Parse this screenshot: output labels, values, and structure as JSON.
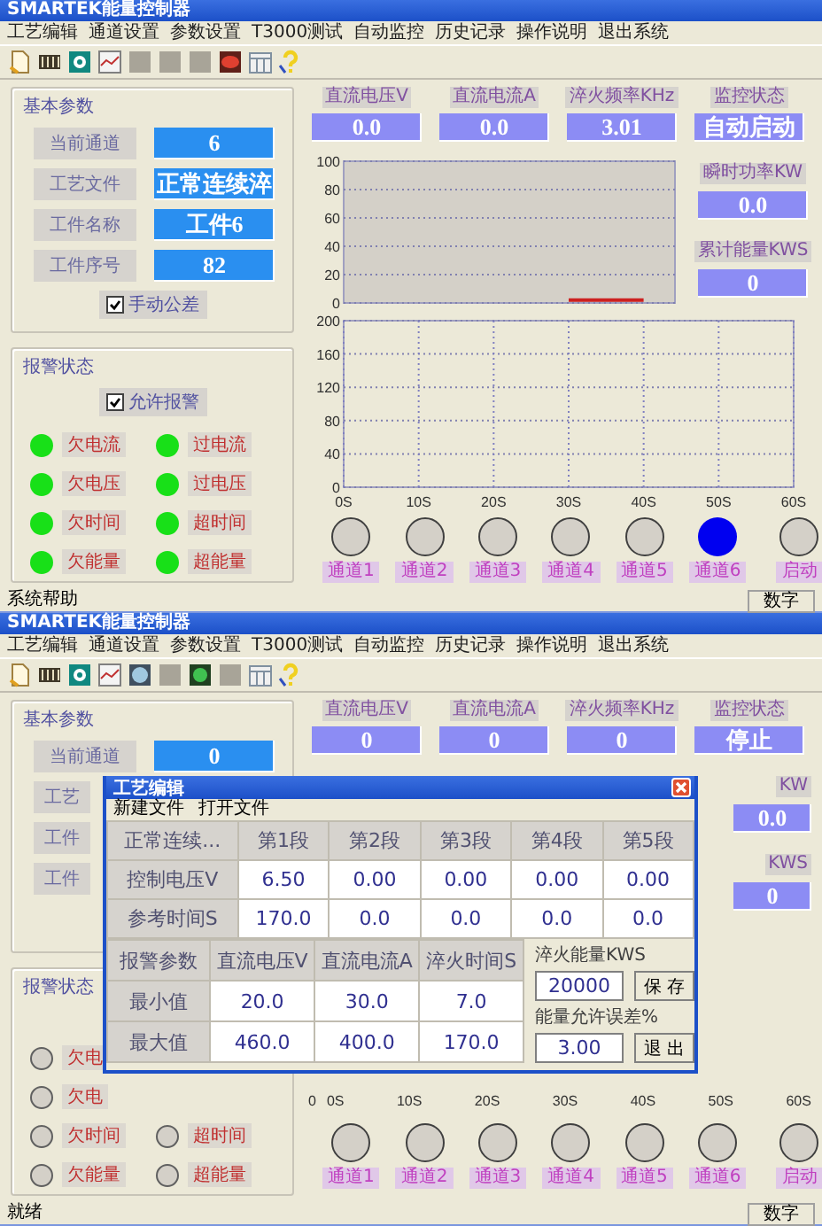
{
  "windows": [
    {
      "title": "SMARTEK能量控制器",
      "menu": [
        "工艺编辑",
        "通道设置",
        "参数设置",
        "T3000测试",
        "自动监控",
        "历史记录",
        "操作说明",
        "退出系统"
      ],
      "toolbar": [
        {
          "kind": "document"
        },
        {
          "kind": "film"
        },
        {
          "kind": "disc"
        },
        {
          "kind": "chart"
        },
        {
          "kind": "blank"
        },
        {
          "kind": "blank"
        },
        {
          "kind": "blank"
        },
        {
          "kind": "oval"
        },
        {
          "kind": "calendar"
        },
        {
          "kind": "help"
        }
      ],
      "basic": {
        "title": "基本参数",
        "fields": [
          {
            "label": "当前通道",
            "value": "6"
          },
          {
            "label": "工艺文件",
            "value": "正常连续淬"
          },
          {
            "label": "工件名称",
            "value": "工件6"
          },
          {
            "label": "工件序号",
            "value": "82"
          }
        ],
        "checkbox": {
          "label": "手动公差",
          "checked": true
        }
      },
      "alarm": {
        "title": "报警状态",
        "enable": {
          "label": "允许报警",
          "checked": true
        },
        "indicators": [
          {
            "kind": "lamp",
            "label": "欠电流",
            "on": true
          },
          {
            "kind": "lamp",
            "label": "过电流",
            "on": true
          },
          {
            "kind": "lamp",
            "label": "欠电压",
            "on": true
          },
          {
            "kind": "lamp",
            "label": "过电压",
            "on": true
          },
          {
            "kind": "lamp",
            "label": "欠时间",
            "on": true
          },
          {
            "kind": "lamp",
            "label": "超时间",
            "on": true
          },
          {
            "kind": "lamp",
            "label": "欠能量",
            "on": true
          },
          {
            "kind": "lamp",
            "label": "超能量",
            "on": true
          }
        ]
      },
      "readouts": [
        {
          "label": "直流电压V",
          "value": "0.0"
        },
        {
          "label": "直流电流A",
          "value": "0.0"
        },
        {
          "label": "淬火频率KHz",
          "value": "3.01"
        },
        {
          "label": "监控状态",
          "value": "自动启动"
        }
      ],
      "side_readouts": [
        {
          "label": "瞬时功率KW",
          "value": "0.0"
        },
        {
          "label": "累计能量KWS",
          "value": "0"
        }
      ],
      "charts": [
        {
          "shaded": true,
          "chart_data": {
            "type": "line",
            "grid": true,
            "xlim": [
              0,
              60
            ],
            "ylim": [
              0,
              100
            ],
            "yticks": [
              0,
              20,
              40,
              60,
              80,
              100
            ],
            "x": [
              30,
              40
            ],
            "series": [
              {
                "color": "#cc2020",
                "values": [
                  2,
                  2
                ]
              }
            ]
          }
        },
        {
          "shaded": false,
          "chart_data": {
            "type": "line",
            "grid": true,
            "xlim": [
              0,
              60
            ],
            "ylim": [
              0,
              200
            ],
            "yticks": [
              0,
              40,
              80,
              120,
              160,
              200
            ],
            "xticks": [
              {
                "value": 0,
                "label": "0S"
              },
              {
                "value": 10,
                "label": "10S"
              },
              {
                "value": 20,
                "label": "20S"
              },
              {
                "value": 30,
                "label": "30S"
              },
              {
                "value": 40,
                "label": "40S"
              },
              {
                "value": 50,
                "label": "50S"
              },
              {
                "value": 60,
                "label": "60S"
              }
            ]
          }
        }
      ],
      "channels": [
        {
          "label": "通道1",
          "selected": false
        },
        {
          "label": "通道2",
          "selected": false
        },
        {
          "label": "通道3",
          "selected": false
        },
        {
          "label": "通道4",
          "selected": false
        },
        {
          "label": "通道5",
          "selected": false
        },
        {
          "label": "通道6",
          "selected": true
        },
        {
          "label": "启动",
          "selected": false
        }
      ],
      "status": {
        "left": "系统帮助",
        "right": "数字"
      }
    },
    {
      "title": "SMARTEK能量控制器",
      "menu": [
        "工艺编辑",
        "通道设置",
        "参数设置",
        "T3000测试",
        "自动监控",
        "历史记录",
        "操作说明",
        "退出系统"
      ],
      "toolbar": [
        {
          "kind": "document"
        },
        {
          "kind": "film"
        },
        {
          "kind": "disc"
        },
        {
          "kind": "chart"
        },
        {
          "kind": "globe"
        },
        {
          "kind": "blank"
        },
        {
          "kind": "gem"
        },
        {
          "kind": "blank"
        },
        {
          "kind": "calendar"
        },
        {
          "kind": "help"
        }
      ],
      "basic": {
        "title": "基本参数",
        "fields": [
          {
            "label": "当前通道",
            "value": "0"
          },
          {
            "label": "工艺"
          },
          {
            "label": "工件"
          },
          {
            "label": "工件"
          }
        ]
      },
      "alarm": {
        "title": "报警状态",
        "indicators": [
          {
            "kind": "lamp",
            "label": "欠电",
            "on": false
          },
          {
            "kind": "covered"
          },
          {
            "kind": "lamp",
            "label": "欠电",
            "on": false
          },
          {
            "kind": "covered"
          },
          {
            "kind": "lamp",
            "label": "欠时间",
            "on": false
          },
          {
            "kind": "lamp",
            "label": "超时间",
            "on": false
          },
          {
            "kind": "lamp",
            "label": "欠能量",
            "on": false
          },
          {
            "kind": "lamp",
            "label": "超能量",
            "on": false
          }
        ]
      },
      "readouts": [
        {
          "label": "直流电压V",
          "value": "0"
        },
        {
          "label": "直流电流A",
          "value": "0"
        },
        {
          "label": "淬火频率KHz",
          "value": "0"
        },
        {
          "label": "监控状态",
          "value": "停止"
        }
      ],
      "side_readouts": [
        {
          "label": "KW",
          "value": "0.0"
        },
        {
          "label": "KWS",
          "value": "0"
        }
      ],
      "axis": {
        "zero": "0",
        "labels": [
          "0S",
          "10S",
          "20S",
          "30S",
          "40S",
          "50S",
          "60S"
        ]
      },
      "channels": [
        {
          "label": "通道1",
          "selected": false
        },
        {
          "label": "通道2",
          "selected": false
        },
        {
          "label": "通道3",
          "selected": false
        },
        {
          "label": "通道4",
          "selected": false
        },
        {
          "label": "通道5",
          "selected": false
        },
        {
          "label": "通道6",
          "selected": false
        },
        {
          "label": "启动",
          "selected": false
        }
      ],
      "dialog": {
        "title": "工艺编辑",
        "menu": [
          "新建文件",
          "打开文件"
        ],
        "segments": {
          "header": [
            "正常连续...",
            "第1段",
            "第2段",
            "第3段",
            "第4段",
            "第5段"
          ],
          "rows": [
            [
              "控制电压V",
              "6.50",
              "0.00",
              "0.00",
              "0.00",
              "0.00"
            ],
            [
              "参考时间S",
              "170.0",
              "0.0",
              "0.0",
              "0.0",
              "0.0"
            ]
          ]
        },
        "limits": {
          "header": [
            "报警参数",
            "直流电压V",
            "直流电流A",
            "淬火时间S"
          ],
          "rows": [
            [
              "最小值",
              "20.0",
              "30.0",
              "7.0"
            ],
            [
              "最大值",
              "460.0",
              "400.0",
              "170.0"
            ]
          ]
        },
        "fields": [
          {
            "label": "淬火能量KWS",
            "value": "20000",
            "button": "保 存"
          },
          {
            "label": "能量允许误差%",
            "value": "3.00",
            "button": "退 出"
          }
        ]
      },
      "status": {
        "left": "就绪",
        "right": "数字"
      }
    }
  ]
}
